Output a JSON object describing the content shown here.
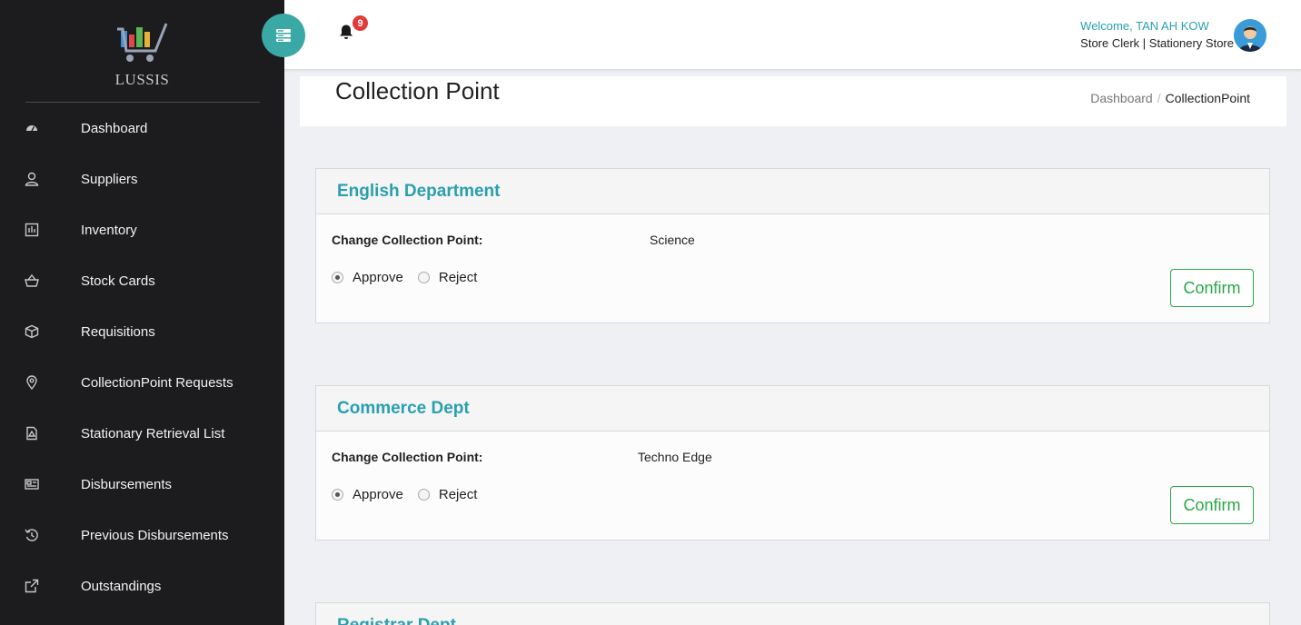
{
  "app": {
    "logo_text": "LUSSIS"
  },
  "sidebar": {
    "items": [
      {
        "label": "Dashboard",
        "icon": "dashboard-icon"
      },
      {
        "label": "Suppliers",
        "icon": "user-icon"
      },
      {
        "label": "Inventory",
        "icon": "inventory-icon"
      },
      {
        "label": "Stock Cards",
        "icon": "basket-icon"
      },
      {
        "label": "Requisitions",
        "icon": "box-icon"
      },
      {
        "label": "CollectionPoint Requests",
        "icon": "location-pin-icon"
      },
      {
        "label": "Stationary Retrieval List",
        "icon": "document-icon"
      },
      {
        "label": "Disbursements",
        "icon": "newspaper-icon"
      },
      {
        "label": "Previous Disbursements",
        "icon": "history-icon"
      },
      {
        "label": "Outstandings",
        "icon": "external-link-icon"
      }
    ]
  },
  "topbar": {
    "notification_count": "9",
    "welcome": "Welcome, TAN AH KOW",
    "role": "Store Clerk | Stationery Store"
  },
  "page": {
    "title": "Collection Point",
    "breadcrumb": {
      "home": "Dashboard",
      "separator": "/",
      "current": "CollectionPoint"
    }
  },
  "requests": [
    {
      "department": "English Department",
      "change_label": "Change Collection Point:",
      "new_point": "Science",
      "approve_label": "Approve",
      "reject_label": "Reject",
      "selected": "approve",
      "confirm_label": "Confirm"
    },
    {
      "department": "Commerce Dept",
      "change_label": "Change Collection Point:",
      "new_point": "Techno Edge",
      "approve_label": "Approve",
      "reject_label": "Reject",
      "selected": "approve",
      "confirm_label": "Confirm"
    },
    {
      "department": "Registrar Dept"
    }
  ],
  "colors": {
    "sidebar_bg": "#1c1c1e",
    "accent_teal": "#3aa8a5",
    "title_blue": "#2a9fb0",
    "confirm_green": "#28a745",
    "badge_red": "#e03a3a"
  }
}
